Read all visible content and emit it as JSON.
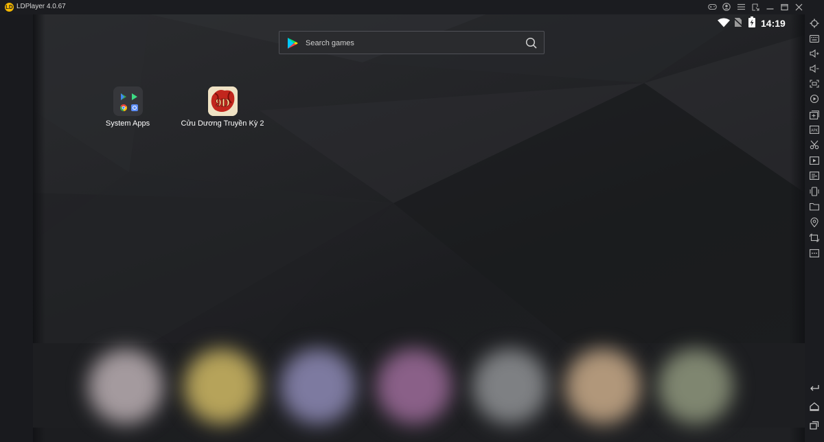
{
  "window": {
    "title": "LDPlayer 4.0.67",
    "logo_text": "LD",
    "titlebar_icons": [
      "gamepad-icon",
      "user-icon",
      "menu-icon",
      "restore-window-icon",
      "minimize-icon",
      "maximize-icon",
      "close-icon"
    ]
  },
  "status_bar": {
    "time": "14:19",
    "icons": [
      "wifi-icon",
      "no-sim-icon",
      "battery-charging-icon"
    ]
  },
  "search": {
    "placeholder": "Search games"
  },
  "desktop_apps": [
    {
      "label": "System Apps",
      "icon": "system-apps-folder-icon"
    },
    {
      "label": "Cửu Dương Truyền Kỳ 2",
      "icon": "game-icon-9d"
    }
  ],
  "dock": {
    "colors": [
      "#a49a9e",
      "#b6a35a",
      "#7d7aa0",
      "#8a6088",
      "#7e8083",
      "#b1977a",
      "#7f8670"
    ]
  },
  "right_toolbar": {
    "top_icons": [
      "settings-icon",
      "keyboard-icon",
      "volume-up-icon",
      "volume-down-icon",
      "fullscreen-icon",
      "sync-icon",
      "add-apk-icon",
      "fps-icon",
      "scissors-icon",
      "video-record-icon",
      "screenshot-icon",
      "shake-icon",
      "folder-icon",
      "location-icon",
      "rotate-icon",
      "more-icon"
    ],
    "bottom_icons": [
      "back-icon",
      "home-icon",
      "recent-apps-icon"
    ]
  },
  "colors": {
    "accent": "#f5b800",
    "titlebar_bg": "#1b1c20",
    "text": "#ffffff"
  }
}
